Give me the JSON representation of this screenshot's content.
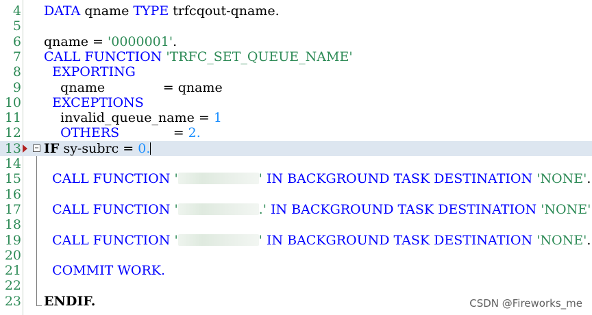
{
  "editor": {
    "lines": [
      {
        "num": "4"
      },
      {
        "num": "5"
      },
      {
        "num": "6"
      },
      {
        "num": "7"
      },
      {
        "num": "8"
      },
      {
        "num": "9"
      },
      {
        "num": "10"
      },
      {
        "num": "11"
      },
      {
        "num": "12"
      },
      {
        "num": "13"
      },
      {
        "num": "14"
      },
      {
        "num": "15"
      },
      {
        "num": "16"
      },
      {
        "num": "17"
      },
      {
        "num": "18"
      },
      {
        "num": "19"
      },
      {
        "num": "20"
      },
      {
        "num": "21"
      },
      {
        "num": "22"
      },
      {
        "num": "23"
      }
    ],
    "tokens": {
      "data": "DATA",
      "qname": "qname",
      "type": "TYPE",
      "trfcqout_qname": "trfcqout-qname.",
      "eq": "=",
      "queue_value": "'0000001'",
      "dot": ".",
      "call": "CALL",
      "function": "FUNCTION",
      "fm_name": "'TRFC_SET_QUEUE_NAME'",
      "exporting": "EXPORTING",
      "exceptions": "EXCEPTIONS",
      "invalid_queue_name": "invalid_queue_name",
      "one": "1",
      "others": "OTHERS",
      "two": "2",
      "if": "IF",
      "sy_subrc": "sy-subrc",
      "zero": "0",
      "quote": "'",
      "quote_dot": ".'",
      "in_background": "IN BACKGROUND TASK DESTINATION",
      "none": "'NONE'",
      "commit": "COMMIT",
      "work": "WORK",
      "endif": "ENDIF"
    },
    "current_line": "13",
    "breakpoint_line": "13",
    "fold_toggle": "−"
  },
  "watermark": "CSDN @Fireworks_me",
  "colors": {
    "keyword": "#0000ff",
    "string": "#2e8b57",
    "number": "#1e90ff",
    "line_number": "#2e8b57",
    "current_line_bg": "#dde6f0",
    "breakpoint": "#b22222"
  }
}
